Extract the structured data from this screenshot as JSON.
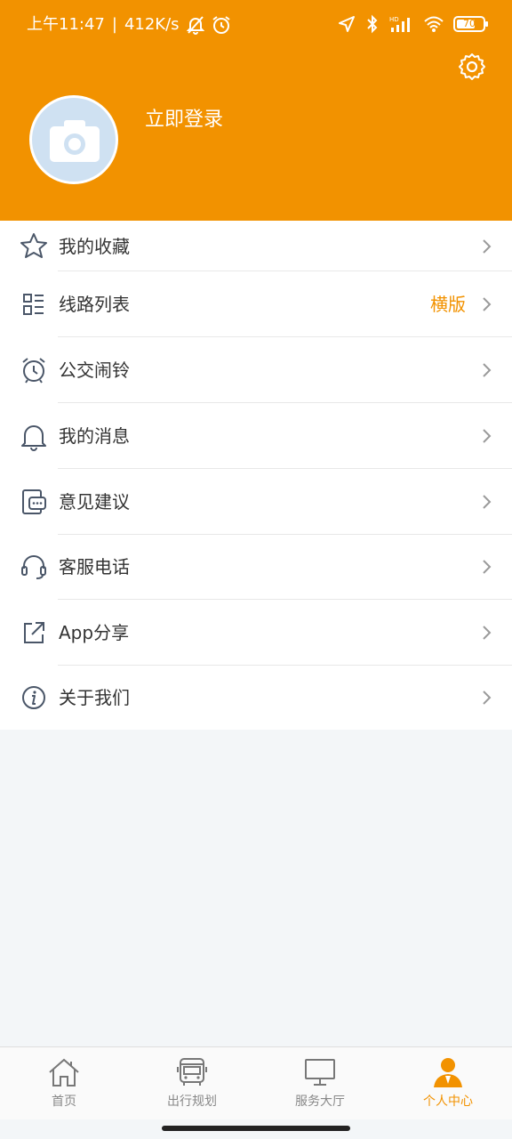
{
  "status_bar": {
    "time": "上午11:47",
    "separator": "|",
    "network_speed": "412K/s",
    "battery_level": "70",
    "icons": [
      "mute-bell-icon",
      "alarm-icon",
      "location-icon",
      "bluetooth-icon",
      "hd-signal-icon",
      "wifi-icon",
      "battery-icon"
    ]
  },
  "header": {
    "login_text": "立即登录",
    "background_color": "#f29200",
    "settings_icon": "gear-icon",
    "avatar_icon": "camera-icon"
  },
  "menu": {
    "items": [
      {
        "label": "我的收藏",
        "icon": "star-icon",
        "extra": ""
      },
      {
        "label": "线路列表",
        "icon": "list-icon",
        "extra": "横版"
      },
      {
        "label": "公交闹铃",
        "icon": "alarm-clock-icon",
        "extra": ""
      },
      {
        "label": "我的消息",
        "icon": "bell-icon",
        "extra": ""
      },
      {
        "label": "意见建议",
        "icon": "feedback-icon",
        "extra": ""
      },
      {
        "label": "客服电话",
        "icon": "headset-icon",
        "extra": ""
      },
      {
        "label": "App分享",
        "icon": "share-icon",
        "extra": ""
      },
      {
        "label": "关于我们",
        "icon": "info-icon",
        "extra": ""
      }
    ]
  },
  "bottom_nav": {
    "items": [
      {
        "label": "首页",
        "icon": "home-icon",
        "active": false
      },
      {
        "label": "出行规划",
        "icon": "bus-icon",
        "active": false
      },
      {
        "label": "服务大厅",
        "icon": "monitor-icon",
        "active": false
      },
      {
        "label": "个人中心",
        "icon": "person-icon",
        "active": true
      }
    ],
    "active_color": "#f29200"
  }
}
